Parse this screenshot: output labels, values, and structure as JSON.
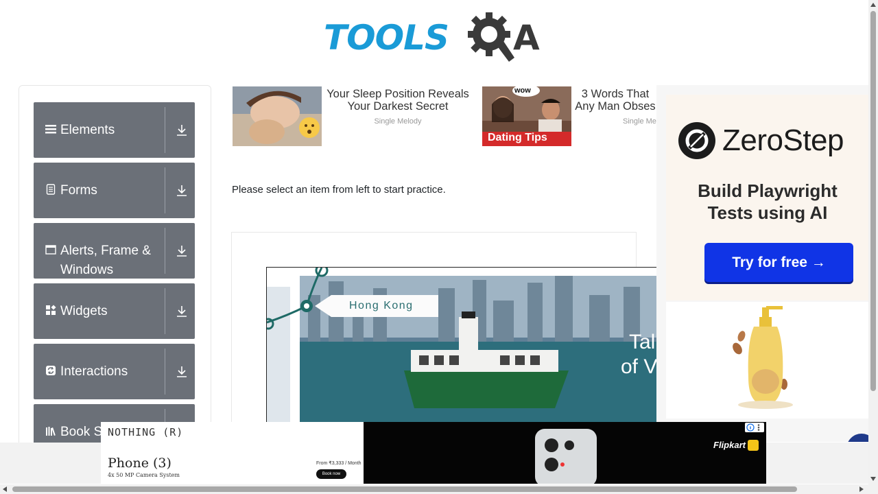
{
  "header": {
    "logo_text": "TOOLS",
    "logo_suffix": "A"
  },
  "sidebar": {
    "groups": [
      {
        "label": "Elements",
        "icon": "hamburger-icon"
      },
      {
        "label": "Forms",
        "icon": "document-icon"
      },
      {
        "label": "Alerts, Frame & Windows",
        "icon": "window-icon"
      },
      {
        "label": "Widgets",
        "icon": "widgets-icon"
      },
      {
        "label": "Interactions",
        "icon": "interactions-icon"
      },
      {
        "label": "Book S",
        "icon": "books-icon"
      }
    ]
  },
  "ads_top": [
    {
      "title": "Your Sleep Position Reveals Your Darkest Secret",
      "source": "Single Melody"
    },
    {
      "title": "3 Words That Any Man Obses",
      "source": "Single Me",
      "badge": "Dating Tips",
      "bubble": "wow"
    }
  ],
  "main": {
    "instruction": "Please select an item from left to start practice."
  },
  "banner": {
    "location": "Hong Kong",
    "overlay_line1": "Tal",
    "overlay_line2": "of V"
  },
  "right_ad": {
    "brand": "ZeroStep",
    "headline": "Build Playwright Tests using AI",
    "cta": "Try for free →"
  },
  "bottom_ad": {
    "brand": "NOTHING (R)",
    "product": "Phone (3)",
    "spec": "4x 50 MP Camera System",
    "price": "From ₹3,333 / Month",
    "cta": "Book now",
    "retailer": "Flipkart"
  },
  "colors": {
    "sidebar_bg": "#6b7078",
    "logo_blue": "#1a9bd7",
    "cta_blue": "#1034e6"
  }
}
